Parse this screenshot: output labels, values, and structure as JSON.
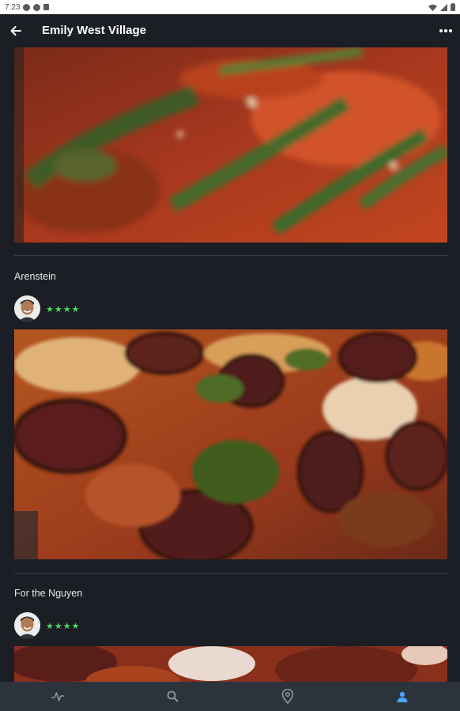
{
  "status_bar": {
    "time": "7:23"
  },
  "app_bar": {
    "title": "Emily West Village"
  },
  "colors": {
    "star": "#4cd964",
    "active_nav": "#4aa3ff",
    "inactive_nav": "#8d95a3"
  },
  "posts": [
    {
      "title": "Arenstein",
      "rating_stars": "★★★★",
      "rating": 4
    },
    {
      "title": "For the Nguyen",
      "rating_stars": "★★★★",
      "rating": 4
    }
  ],
  "bottom_nav": [
    {
      "icon": "activity-icon",
      "active": false
    },
    {
      "icon": "search-icon",
      "active": false
    },
    {
      "icon": "location-pin-icon",
      "active": false
    },
    {
      "icon": "profile-icon",
      "active": true
    }
  ]
}
